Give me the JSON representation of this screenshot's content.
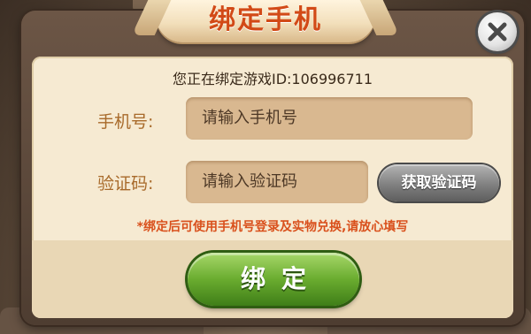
{
  "dialog": {
    "title": "绑定手机",
    "close_icon": "close-icon"
  },
  "info": {
    "binding_prefix": "您正在绑定游戏ID:",
    "game_id": "106996711"
  },
  "form": {
    "phone_label": "手机号:",
    "phone_placeholder": "请输入手机号",
    "code_label": "验证码:",
    "code_placeholder": "请输入验证码",
    "get_code_label": "获取验证码"
  },
  "notice": "*绑定后可使用手机号登录及实物兑换,请放心填写",
  "actions": {
    "bind_label": "绑定"
  },
  "colors": {
    "title": "#d24a17",
    "label": "#a86a2a",
    "notice": "#d9501c",
    "bind_button": "#6aac2f",
    "get_code_button": "#7c7c7c"
  }
}
